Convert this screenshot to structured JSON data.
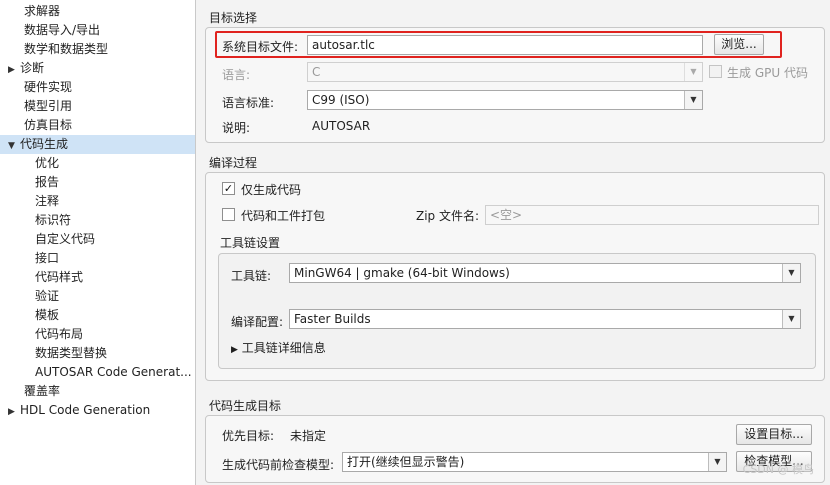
{
  "sidebar": {
    "items": [
      {
        "label": "求解器",
        "level": 0,
        "arrow": "",
        "selected": false
      },
      {
        "label": "数据导入/导出",
        "level": 0,
        "arrow": "",
        "selected": false
      },
      {
        "label": "数学和数据类型",
        "level": 0,
        "arrow": "",
        "selected": false
      },
      {
        "label": "诊断",
        "level": 0,
        "arrow": "▶",
        "selected": false
      },
      {
        "label": "硬件实现",
        "level": 0,
        "arrow": "",
        "selected": false
      },
      {
        "label": "模型引用",
        "level": 0,
        "arrow": "",
        "selected": false
      },
      {
        "label": "仿真目标",
        "level": 0,
        "arrow": "",
        "selected": false
      },
      {
        "label": "代码生成",
        "level": 0,
        "arrow": "▼",
        "selected": true
      },
      {
        "label": "优化",
        "level": 1,
        "arrow": "",
        "selected": false
      },
      {
        "label": "报告",
        "level": 1,
        "arrow": "",
        "selected": false
      },
      {
        "label": "注释",
        "level": 1,
        "arrow": "",
        "selected": false
      },
      {
        "label": "标识符",
        "level": 1,
        "arrow": "",
        "selected": false
      },
      {
        "label": "自定义代码",
        "level": 1,
        "arrow": "",
        "selected": false
      },
      {
        "label": "接口",
        "level": 1,
        "arrow": "",
        "selected": false
      },
      {
        "label": "代码样式",
        "level": 1,
        "arrow": "",
        "selected": false
      },
      {
        "label": "验证",
        "level": 1,
        "arrow": "",
        "selected": false
      },
      {
        "label": "模板",
        "level": 1,
        "arrow": "",
        "selected": false
      },
      {
        "label": "代码布局",
        "level": 1,
        "arrow": "",
        "selected": false
      },
      {
        "label": "数据类型替换",
        "level": 1,
        "arrow": "",
        "selected": false
      },
      {
        "label": "AUTOSAR Code Generat...",
        "level": 1,
        "arrow": "",
        "selected": false
      },
      {
        "label": "覆盖率",
        "level": 0,
        "arrow": "",
        "selected": false
      },
      {
        "label": "HDL Code Generation",
        "level": 0,
        "arrow": "▶",
        "selected": false
      }
    ]
  },
  "target": {
    "title": "目标选择",
    "sys_target_label": "系统目标文件:",
    "sys_target_value": "autosar.tlc",
    "browse_label": "浏览...",
    "language_label": "语言:",
    "language_value": "C",
    "gpu_label": "生成 GPU 代码",
    "std_label": "语言标准:",
    "std_value": "C99 (ISO)",
    "desc_label": "说明:",
    "desc_value": "AUTOSAR"
  },
  "build": {
    "title": "编译过程",
    "gen_only_label": "仅生成代码",
    "gen_only_checked": "✓",
    "package_label": "代码和工件打包",
    "zip_label": "Zip 文件名:",
    "zip_placeholder": "<空>",
    "toolchain_group": "工具链设置",
    "toolchain_label": "工具链:",
    "toolchain_value": "MinGW64 | gmake (64-bit Windows)",
    "config_label": "编译配置:",
    "config_value": "Faster Builds",
    "details_arrow": "▶",
    "details_label": "工具链详细信息"
  },
  "objectives": {
    "title": "代码生成目标",
    "priority_label": "优先目标:",
    "priority_value": "未指定",
    "set_btn": "设置目标...",
    "check_label": "生成代码前检查模型:",
    "check_value": "打开(继续但显示警告)",
    "check_btn": "检查模型..."
  },
  "watermark": "CSDN @ 模鸟",
  "colors": {
    "selected_bg": "#cfe3f6",
    "highlight": "#e0231f"
  }
}
